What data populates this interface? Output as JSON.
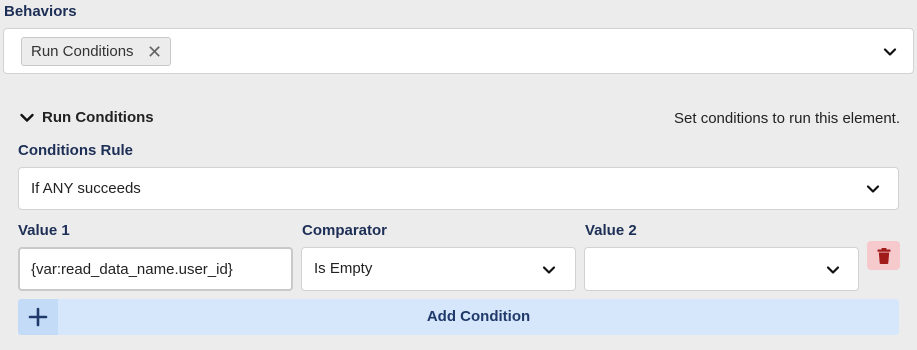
{
  "behaviors": {
    "label": "Behaviors",
    "selected_tag": "Run Conditions",
    "remove_glyph": "✕"
  },
  "run_conditions": {
    "title": "Run Conditions",
    "description": "Set conditions to run this element.",
    "rule_label": "Conditions Rule",
    "rule_value": "If ANY succeeds",
    "columns": {
      "value1": "Value 1",
      "comparator": "Comparator",
      "value2": "Value 2"
    },
    "condition": {
      "value1": "{var:read_data_name.user_id}",
      "comparator": "Is Empty",
      "value2": ""
    },
    "add_label": "Add Condition"
  },
  "colors": {
    "heading": "#1d2f56",
    "add_bg": "#d6e6fb",
    "trash_bg": "#f6c9cc",
    "trash_icon": "#a11b1b"
  },
  "icons": [
    "chevron-down-icon",
    "remove-x-icon",
    "trash-icon",
    "plus-icon"
  ]
}
